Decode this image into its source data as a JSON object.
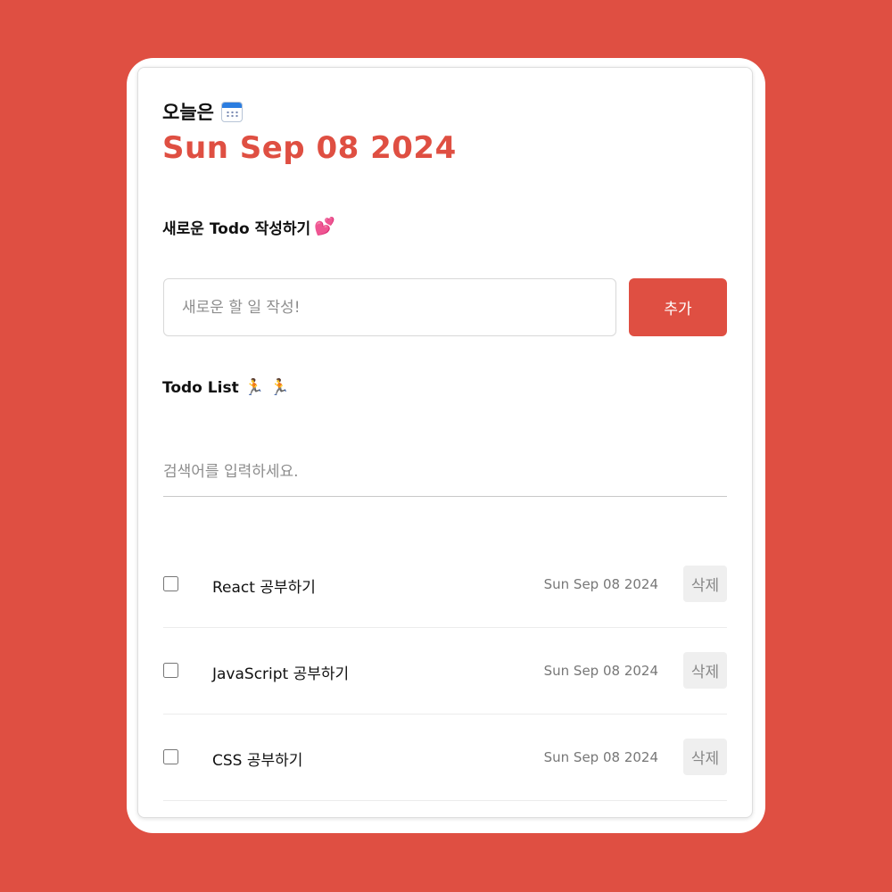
{
  "header": {
    "today_label": "오늘은",
    "calendar_icon": "calendar-icon",
    "date": "Sun Sep 08 2024"
  },
  "editor": {
    "title": "새로운 Todo 작성하기",
    "title_icon": "heart-icon",
    "input_value": "",
    "input_placeholder": "새로운 할 일 작성!",
    "add_button_label": "추가"
  },
  "list": {
    "title": "Todo List",
    "title_icons": [
      "runner-icon",
      "runner-icon"
    ],
    "search_value": "",
    "search_placeholder": "검색어를 입력하세요.",
    "items": [
      {
        "checked": false,
        "content": "React 공부하기",
        "date": "Sun Sep 08 2024",
        "delete_label": "삭제"
      },
      {
        "checked": false,
        "content": "JavaScript 공부하기",
        "date": "Sun Sep 08 2024",
        "delete_label": "삭제"
      },
      {
        "checked": false,
        "content": "CSS 공부하기",
        "date": "Sun Sep 08 2024",
        "delete_label": "삭제"
      }
    ]
  },
  "colors": {
    "accent": "#df4f42",
    "background": "#df4f42",
    "card": "#ffffff",
    "delete_button_bg": "#efefef"
  }
}
